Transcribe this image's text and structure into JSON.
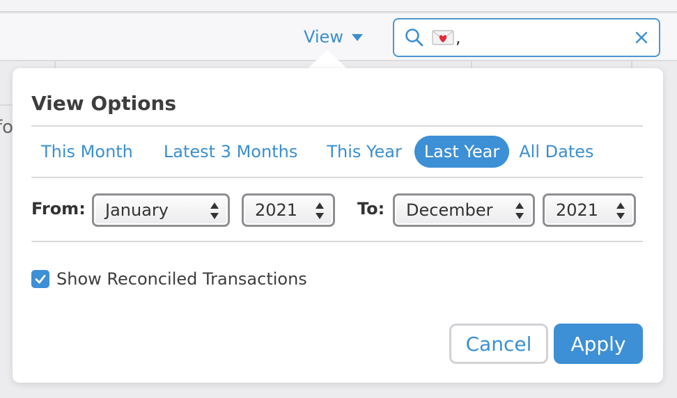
{
  "toolbar": {
    "view_label": "View",
    "search": {
      "value": ",",
      "query_icon": "envelope-with-heart-icon"
    }
  },
  "background": {
    "partial_text": "fo"
  },
  "popover": {
    "title": "View Options",
    "tabs": [
      {
        "label": "This Month",
        "active": false
      },
      {
        "label": "Latest 3 Months",
        "active": false
      },
      {
        "label": "This Year",
        "active": false
      },
      {
        "label": "Last Year",
        "active": true
      },
      {
        "label": "All Dates",
        "active": false
      }
    ],
    "from_label": "From:",
    "from_month": "January",
    "from_year": "2021",
    "to_label": "To:",
    "to_month": "December",
    "to_year": "2021",
    "show_reconciled": {
      "label": "Show Reconciled Transactions",
      "checked": true
    },
    "cancel_label": "Cancel",
    "apply_label": "Apply"
  },
  "colors": {
    "accent": "#3d8fd6",
    "link": "#3a8fd1",
    "select_border": "#8e8e92"
  }
}
